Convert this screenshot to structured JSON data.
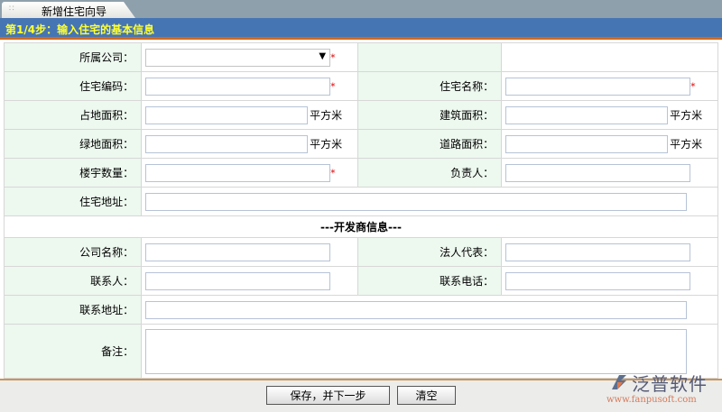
{
  "tab": {
    "title": "新增住宅向导"
  },
  "step": "第1/4步：输入住宅的基本信息",
  "fields": {
    "company": "所属公司：",
    "code": "住宅编码：",
    "name": "住宅名称：",
    "land_area": "占地面积：",
    "build_area": "建筑面积：",
    "green_area": "绿地面积：",
    "road_area": "道路面积：",
    "building_count": "楼宇数量：",
    "manager": "负责人：",
    "address": "住宅地址："
  },
  "unit": "平方米",
  "required_mark": "*",
  "developer": {
    "section_title": "---开发商信息---",
    "company_name": "公司名称：",
    "legal_rep": "法人代表：",
    "contact": "联系人：",
    "phone": "联系电话：",
    "address": "联系地址：",
    "remark": "备注："
  },
  "buttons": {
    "save_next": "保存，并下一步",
    "clear": "清空"
  },
  "logo": {
    "name": "泛普软件",
    "url": "www.fanpusoft.com"
  },
  "colors": {
    "step_bar": "#4675b4",
    "step_text": "#ffff33",
    "label_bg": "#edf8ef",
    "accent_line": "#d2691e"
  }
}
